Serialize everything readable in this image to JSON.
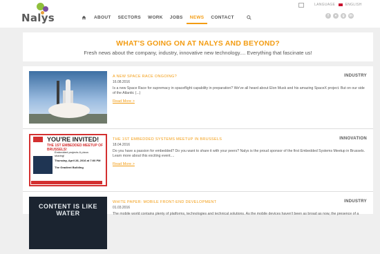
{
  "header": {
    "logo_text": "Nalys",
    "language_label": "LANGUAGE",
    "language_value": "ENGLISH",
    "nav": [
      {
        "label": "ABOUT"
      },
      {
        "label": "SECTORS"
      },
      {
        "label": "WORK"
      },
      {
        "label": "JOBS"
      },
      {
        "label": "NEWS",
        "active": true
      },
      {
        "label": "CONTACT"
      }
    ],
    "social_icons": [
      "facebook-icon",
      "github-icon",
      "google-plus-icon",
      "linkedin-icon"
    ],
    "accent_color": "#f39c12"
  },
  "hero": {
    "title": "WHAT'S GOING ON AT NALYS AND BEYOND?",
    "subtitle": "Fresh news about the company, industry, innovative new technology.... Everything that fascinate us!"
  },
  "articles": [
    {
      "title": "A NEW SPACE RACE ONGOING?",
      "date": "16.08.2016",
      "category": "INDUSTRY",
      "excerpt": "Is a new Space Race for supremacy in spaceflight capability in preparation? We've all heard about Elon Musk and his amazing SpaceX project. But on our side of the Atlantic (...)",
      "read_more": "Read More >"
    },
    {
      "title": "THE 1ST EMBEDDED SYSTEMS MEETUP IN BRUSSELS",
      "date": "18.04.2016",
      "category": "INNOVATION",
      "excerpt": "Do you have a passion for embedded? Do you want to share it with your peers? Nalys is the proud sponsor of the first Embedded Systems Meetup in Brussels. Learn more about this exciting event....",
      "read_more": "Read More >",
      "image_text": {
        "heading": "YOU'RE INVITED!",
        "subheading": "THE 1ST EMBEDDED MEETUP OF BRUSSELS!",
        "line1": "Embedded projects & pizza sharing!",
        "line2": "Thursday, April 28, 2016 at 7:00 PM",
        "line3": "The Gradient Building"
      }
    },
    {
      "title": "WHITE PAPER: MOBILE FRONT-END DEVELOPMENT",
      "date": "01.03.2016",
      "category": "INDUSTRY",
      "excerpt": "The mobile world contains plenty of platforms, technologies and technical solutions. As the mobile devices haven't been as broad as now, the presence of a",
      "image_text": {
        "heading": "CONTENT IS LIKE WATER"
      }
    }
  ]
}
